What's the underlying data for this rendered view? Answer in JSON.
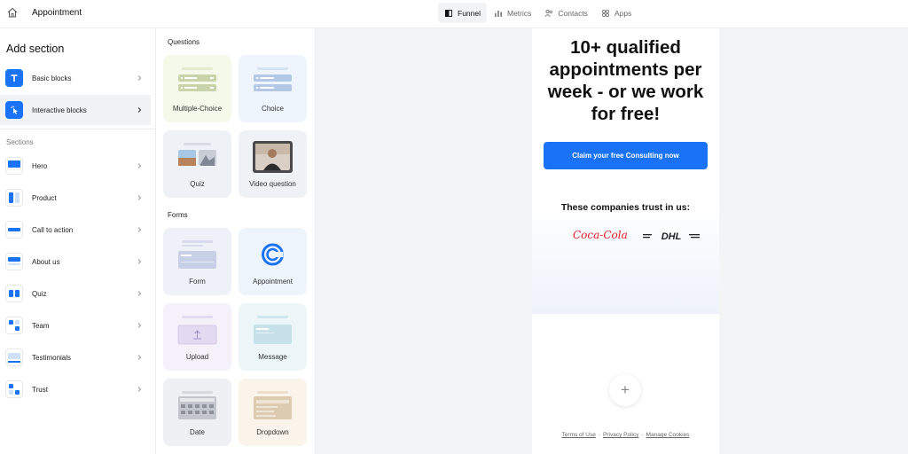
{
  "app": {
    "title": "Appointment"
  },
  "nav": {
    "tabs": [
      {
        "label": "Funnel",
        "icon": "funnel-icon",
        "active": true
      },
      {
        "label": "Metrics",
        "icon": "bar-chart-icon",
        "active": false
      },
      {
        "label": "Contacts",
        "icon": "users-icon",
        "active": false
      },
      {
        "label": "Apps",
        "icon": "grid-icon",
        "active": false
      }
    ]
  },
  "sidebar": {
    "title": "Add section",
    "categories": [
      {
        "label": "Basic blocks",
        "icon": "text-icon",
        "active": false
      },
      {
        "label": "Interactive blocks",
        "icon": "pointer-icon",
        "active": true
      }
    ],
    "sections_label": "Sections",
    "sections": [
      {
        "label": "Hero"
      },
      {
        "label": "Product"
      },
      {
        "label": "Call to action"
      },
      {
        "label": "About us"
      },
      {
        "label": "Quiz"
      },
      {
        "label": "Team"
      },
      {
        "label": "Testimonials"
      },
      {
        "label": "Trust"
      }
    ]
  },
  "blocks": {
    "questions_label": "Questions",
    "questions": [
      {
        "label": "Multiple-Choice"
      },
      {
        "label": "Choice"
      },
      {
        "label": "Quiz"
      },
      {
        "label": "Video question"
      }
    ],
    "forms_label": "Forms",
    "forms": [
      {
        "label": "Form"
      },
      {
        "label": "Appointment"
      },
      {
        "label": "Upload"
      },
      {
        "label": "Message"
      },
      {
        "label": "Date"
      },
      {
        "label": "Dropdown"
      }
    ]
  },
  "preview": {
    "headline": "10+ qualified appointments per week - or we work for free!",
    "cta_label": "Claim your free Consulting now",
    "trust_title": "These companies trust in us:",
    "logos": [
      "Coca-Cola",
      "DHL"
    ],
    "add_button": "+",
    "footer": {
      "terms": "Terms of Use",
      "privacy": "Privacy Policy",
      "cookies": "Manage Cookies",
      "separator": "·"
    }
  },
  "colors": {
    "accent": "#1a73f6",
    "canvas_bg": "#f3f4f6",
    "active_tab_bg": "#f2f3f5"
  }
}
